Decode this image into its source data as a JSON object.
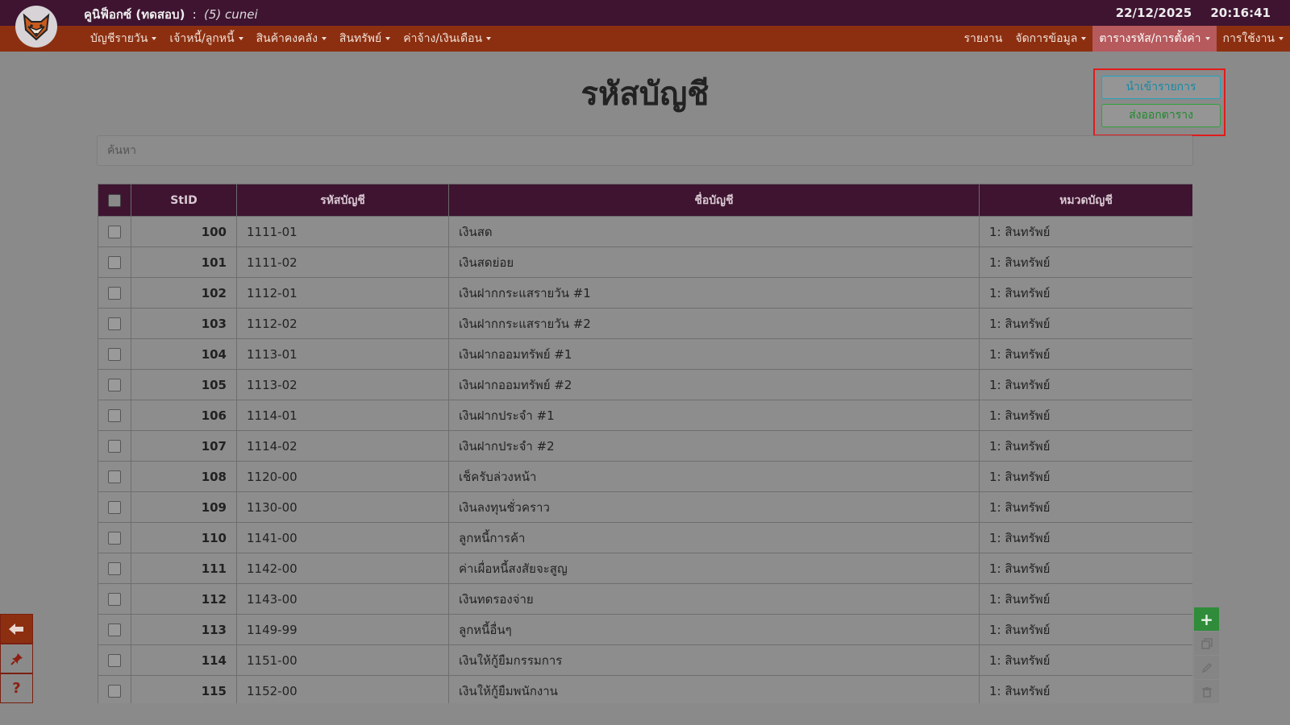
{
  "app": {
    "title": "คูนิฟ็อกซ์ (ทดสอบ)",
    "separator": ":",
    "user": "(5)  cunei",
    "date": "22/12/2025",
    "time": "20:16:41"
  },
  "menu": {
    "left": [
      {
        "label": "บัญชีรายวัน",
        "dropdown": true
      },
      {
        "label": "เจ้าหนี้/ลูกหนี้",
        "dropdown": true
      },
      {
        "label": "สินค้าคงคลัง",
        "dropdown": true
      },
      {
        "label": "สินทรัพย์",
        "dropdown": true
      },
      {
        "label": "ค่าจ้าง/เงินเดือน",
        "dropdown": true
      }
    ],
    "right": [
      {
        "label": "รายงาน",
        "dropdown": false,
        "active": false
      },
      {
        "label": "จัดการข้อมูล",
        "dropdown": true,
        "active": false
      },
      {
        "label": "ตารางรหัส/การตั้งค่า",
        "dropdown": true,
        "active": true
      },
      {
        "label": "การใช้งาน",
        "dropdown": true,
        "active": false
      }
    ]
  },
  "page": {
    "title": "รหัสบัญชี",
    "import_label": "นำเข้ารายการ",
    "export_label": "ส่งออกตาราง",
    "search_placeholder": "ค้นหา"
  },
  "table": {
    "headers": [
      "StID",
      "รหัสบัญชี",
      "ชื่อบัญชี",
      "หมวดบัญชี"
    ],
    "rows": [
      {
        "stid": "100",
        "code": "1111-01",
        "name": "เงินสด",
        "category": "1: สินทรัพย์"
      },
      {
        "stid": "101",
        "code": "1111-02",
        "name": "เงินสดย่อย",
        "category": "1: สินทรัพย์"
      },
      {
        "stid": "102",
        "code": "1112-01",
        "name": "เงินฝากกระแสรายวัน #1",
        "category": "1: สินทรัพย์"
      },
      {
        "stid": "103",
        "code": "1112-02",
        "name": "เงินฝากกระแสรายวัน #2",
        "category": "1: สินทรัพย์"
      },
      {
        "stid": "104",
        "code": "1113-01",
        "name": "เงินฝากออมทรัพย์ #1",
        "category": "1: สินทรัพย์"
      },
      {
        "stid": "105",
        "code": "1113-02",
        "name": "เงินฝากออมทรัพย์ #2",
        "category": "1: สินทรัพย์"
      },
      {
        "stid": "106",
        "code": "1114-01",
        "name": "เงินฝากประจำ #1",
        "category": "1: สินทรัพย์"
      },
      {
        "stid": "107",
        "code": "1114-02",
        "name": "เงินฝากประจำ #2",
        "category": "1: สินทรัพย์"
      },
      {
        "stid": "108",
        "code": "1120-00",
        "name": "เช็ครับล่วงหน้า",
        "category": "1: สินทรัพย์"
      },
      {
        "stid": "109",
        "code": "1130-00",
        "name": "เงินลงทุนชั่วคราว",
        "category": "1: สินทรัพย์"
      },
      {
        "stid": "110",
        "code": "1141-00",
        "name": "ลูกหนี้การค้า",
        "category": "1: สินทรัพย์"
      },
      {
        "stid": "111",
        "code": "1142-00",
        "name": "ค่าเผื่อหนี้สงสัยจะสูญ",
        "category": "1: สินทรัพย์"
      },
      {
        "stid": "112",
        "code": "1143-00",
        "name": "เงินทดรองจ่าย",
        "category": "1: สินทรัพย์"
      },
      {
        "stid": "113",
        "code": "1149-99",
        "name": "ลูกหนี้อื่นๆ",
        "category": "1: สินทรัพย์"
      },
      {
        "stid": "114",
        "code": "1151-00",
        "name": "เงินให้กู้ยืมกรรมการ",
        "category": "1: สินทรัพย์"
      },
      {
        "stid": "115",
        "code": "1152-00",
        "name": "เงินให้กู้ยืมพนักงาน",
        "category": "1: สินทรัพย์"
      }
    ]
  },
  "icons": {
    "logo": "fox-logo-icon",
    "back": "arrow-left-icon",
    "pin": "pin-icon",
    "help": "question-icon",
    "add": "plus-icon",
    "copy": "copy-icon",
    "edit": "pencil-icon",
    "delete": "trash-icon"
  },
  "colors": {
    "topbar": "#3e1431",
    "menubar": "#8c2f10",
    "active_menu": "#b65a5d",
    "highlight_box": "#e21b1b",
    "import_accent": "#1fa4c1",
    "export_accent": "#30a13a",
    "add_button": "#2f8c3a"
  }
}
